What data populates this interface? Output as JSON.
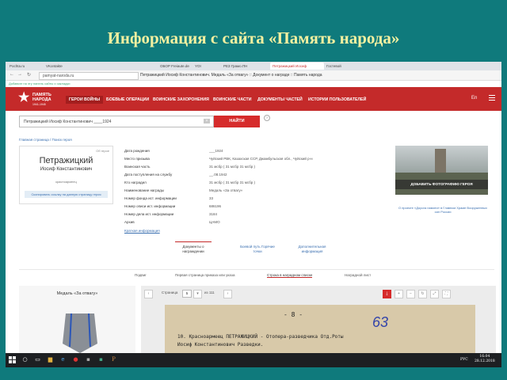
{
  "slide": {
    "title": "Информация с сайта «Память народа»"
  },
  "browser": {
    "tabs": [
      "Pochta.ru",
      "VKontakte",
      "ОБОР Freiaute.de",
      "YOI",
      "РЕЗ Грамо.ПН",
      "Петражицкий Иосиф",
      "Гостевой"
    ],
    "url": "pamyat-naroda.ru",
    "page_title": "Петражицкий Иосиф Константинович. Медаль «За отвагу» :: Документ о награде :: Память народа",
    "bookmarks": "Добавьте на эту панель сайты и закладки"
  },
  "site": {
    "logo_lines": [
      "ПАМЯТЬ",
      "НАРОДА"
    ],
    "logo_sub": "1941-1945",
    "nav": [
      "ГЕРОИ ВОЙНЫ",
      "БОЕВЫЕ ОПЕРАЦИИ",
      "ВОИНСКИЕ ЗАХОРОНЕНИЯ",
      "ВОИНСКИЕ ЧАСТИ",
      "ДОКУМЕНТЫ ЧАСТЕЙ",
      "ИСТОРИИ ПОЛЬЗОВАТЕЛЕЙ"
    ],
    "lang": "En"
  },
  "search": {
    "value": "Петражицкий Иосиф Константинович ____1924",
    "button": "НАЙТИ",
    "help": "?"
  },
  "breadcrumb": "Главная страница / Поиск героя",
  "person": {
    "hero_link": "Об герое",
    "surname": "Петражицкий",
    "name": "Иосиф Константинович",
    "rank": "красноармеец",
    "copy_button": "Скопировать ссылку на данную страницу героя"
  },
  "info_rows": [
    {
      "k": "Дата рождения",
      "v": "___1924"
    },
    {
      "k": "Место призыва",
      "v": "Чуйский РВК, Казахская ССР, Джамбульская обл., Чуйский р-н"
    },
    {
      "k": "Воинская часть",
      "v": "31 мсбр ( 31 мсбр 31 мсбр )"
    },
    {
      "k": "Дата поступления на службу",
      "v": "__.08.1942"
    },
    {
      "k": "Кто наградил",
      "v": "31 мсбр ( 31 мсбр 31 мсбр )"
    },
    {
      "k": "Наименование награды",
      "v": "Медаль «За отвагу»"
    },
    {
      "k": "Номер фонда ист. информации",
      "v": "33"
    },
    {
      "k": "Номер описи ист. информации",
      "v": "686196"
    },
    {
      "k": "Номер дела ист. информации",
      "v": "3184"
    },
    {
      "k": "Архив",
      "v": "ЦАМО"
    }
  ],
  "short_info_link": "Краткая информация",
  "promo": {
    "banner": "ДОБАВИТЬ ФОТОГРАФИЮ ГЕРОЯ",
    "note": "О проекте «Дорога памяти» в Главном Храме Вооруженных сил России"
  },
  "subtabs": [
    "Документы о награждении",
    "Боевой путь Горячие точки",
    "Дополнительная информация"
  ],
  "doctabs": [
    "Подвиг",
    "Первая страница приказа или указа",
    "Строка в наградном списке",
    "Наградной лист"
  ],
  "medal": {
    "title": "Медаль «За отвагу»"
  },
  "viewer": {
    "page_label": "Страница",
    "page_value": "5",
    "page_of": "из 111",
    "paper_num": "- 8 -",
    "line1": "10. Красноармеец ПЕТРАЖИЦКИЙ -  Отопера-разведчика Отд.Роты",
    "line2": "    Иосиф Константинович         Разведки.",
    "handwritten": "63"
  },
  "taskbar": {
    "lang": "РУС",
    "time": "16:04",
    "date": "28.12.2018"
  },
  "colors": {
    "brand_red": "#c42a2a",
    "slide_bg": "#0f7a7c",
    "title_yellow": "#f4f0a0"
  }
}
